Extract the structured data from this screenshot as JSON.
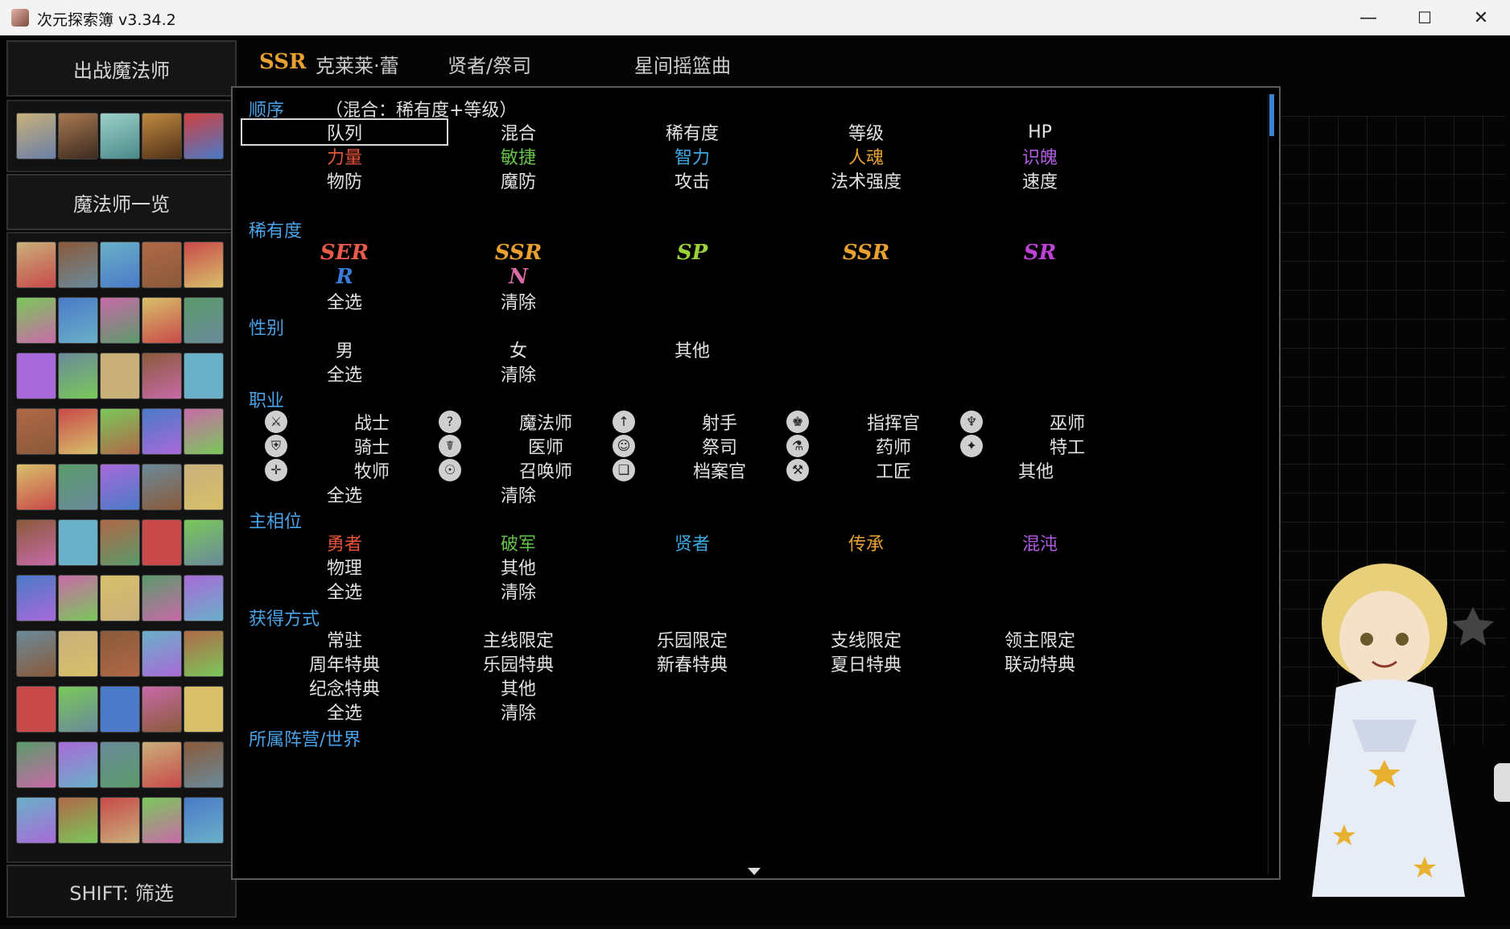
{
  "window": {
    "title": "次元探索簿 v3.34.2",
    "min": "—",
    "max": "☐",
    "close": "✕"
  },
  "left": {
    "party_header": "出战魔法师",
    "list_header": "魔法师一览",
    "shift_hint": "SHIFT: 筛选"
  },
  "detail_back": {
    "rarity": "SSR",
    "name": "克莱莱·蕾",
    "job_line": "贤者/祭司",
    "song": "星间摇篮曲"
  },
  "filter": {
    "order": {
      "title": "顺序",
      "current": "（混合：稀有度+等级）",
      "rows": [
        [
          "队列",
          "混合",
          "稀有度",
          "等级",
          "HP"
        ],
        [
          "力量",
          "敏捷",
          "智力",
          "人魂",
          "识魄"
        ],
        [
          "物防",
          "魔防",
          "攻击",
          "法术强度",
          "速度"
        ]
      ]
    },
    "rarity": {
      "title": "稀有度",
      "items": [
        "SER",
        "SSR",
        "SP",
        "SSR",
        "SR"
      ],
      "items2": [
        "R",
        "N"
      ],
      "select_all": "全选",
      "clear": "清除"
    },
    "gender": {
      "title": "性别",
      "items": [
        "男",
        "女",
        "其他"
      ],
      "select_all": "全选",
      "clear": "清除"
    },
    "job": {
      "title": "职业",
      "items": [
        [
          "战士",
          "魔法师",
          "射手",
          "指挥官",
          "巫师"
        ],
        [
          "骑士",
          "医师",
          "祭司",
          "药师",
          "特工"
        ],
        [
          "牧师",
          "召唤师",
          "档案官",
          "工匠",
          "其他"
        ]
      ],
      "select_all": "全选",
      "clear": "清除"
    },
    "phase": {
      "title": "主相位",
      "items": [
        "勇者",
        "破军",
        "贤者",
        "传承",
        "混沌"
      ],
      "items2": [
        "物理",
        "其他"
      ],
      "select_all": "全选",
      "clear": "清除"
    },
    "obtain": {
      "title": "获得方式",
      "items": [
        [
          "常驻",
          "主线限定",
          "乐园限定",
          "支线限定",
          "领主限定"
        ],
        [
          "周年特典",
          "乐园特典",
          "新春特典",
          "夏日特典",
          "联动特典"
        ],
        [
          "纪念特典",
          "其他"
        ]
      ],
      "select_all": "全选",
      "clear": "清除"
    },
    "camp": {
      "title": "所属阵营/世界"
    }
  },
  "colors": {
    "section": "#4aa3e8",
    "str": "#e8543a",
    "agi": "#66c24a",
    "int": "#3ea8e0",
    "soul": "#e8a030",
    "mind": "#b05ce0",
    "ser": "#e85a4a",
    "ssr": "#e8a030",
    "sp": "#9ad23a",
    "sr": "#c040d8",
    "r": "#3c7ad8",
    "n": "#d86aa8"
  }
}
